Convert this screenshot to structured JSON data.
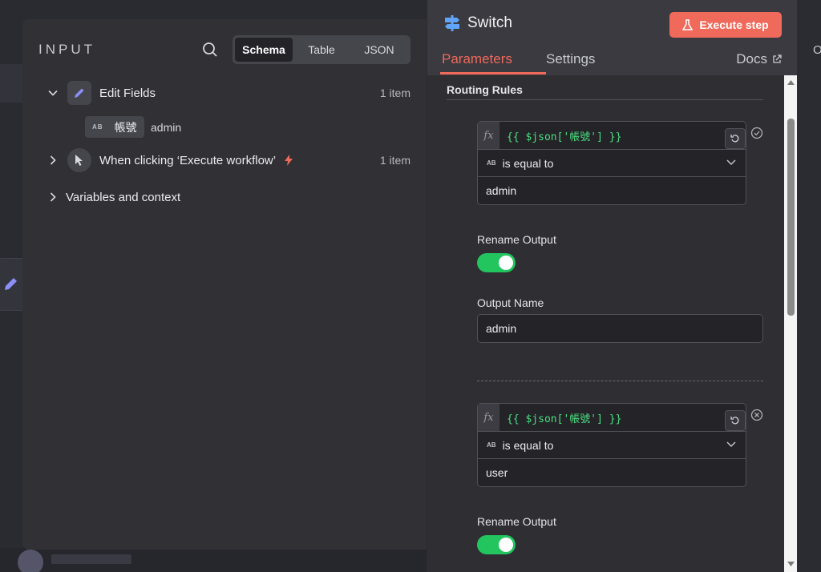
{
  "input": {
    "title": "INPUT",
    "views": [
      "Schema",
      "Table",
      "JSON"
    ],
    "active_view": "Schema",
    "nodes": [
      {
        "name": "Edit Fields",
        "count": "1 item",
        "expanded": true,
        "fields": [
          {
            "type": "AB",
            "key": "帳號",
            "value": "admin"
          }
        ]
      },
      {
        "name": "When clicking ‘Execute workflow’",
        "count": "1 item",
        "expanded": false
      }
    ],
    "context_label": "Variables and context"
  },
  "node": {
    "title": "Switch",
    "execute_label": "Execute step",
    "tabs": [
      "Parameters",
      "Settings"
    ],
    "active_tab": "Parameters",
    "docs_label": "Docs"
  },
  "params": {
    "section_title": "Routing Rules",
    "rules": [
      {
        "fx": "fx",
        "expression": "{{ $json['帳號'] }}",
        "operator_type": "AB",
        "operator": "is equal to",
        "value": "admin",
        "rename_label": "Rename Output",
        "rename_on": true,
        "output_name_label": "Output Name",
        "output_name": "admin",
        "status_icon": "check-circle-icon"
      },
      {
        "fx": "fx",
        "expression": "{{ $json['帳號'] }}",
        "operator_type": "AB",
        "operator": "is equal to",
        "value": "user",
        "rename_label": "Rename Output",
        "rename_on": true,
        "status_icon": "remove-circle-icon"
      }
    ]
  },
  "colors": {
    "accent": "#ef6a5b",
    "toggle_on": "#22c55e",
    "expression_green": "#4ade80",
    "switch_icon": "#60a5fa"
  },
  "right_edge_label": "O"
}
